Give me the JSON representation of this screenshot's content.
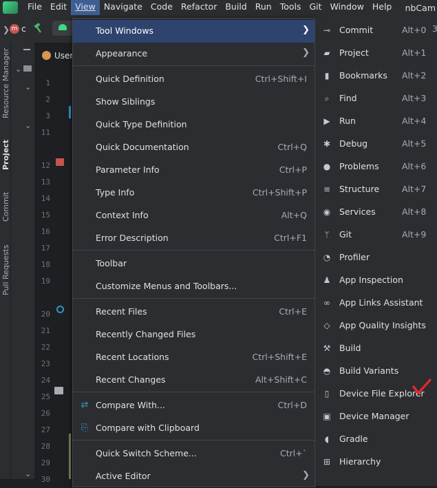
{
  "menubar": {
    "items": [
      "File",
      "Edit",
      "View",
      "Navigate",
      "Code",
      "Refactor",
      "Build",
      "Run",
      "Tools",
      "Git",
      "Window",
      "Help"
    ],
    "active": "View",
    "project_name": "nbCam"
  },
  "toolbar": {
    "project_badge": "m",
    "project_letter": "c"
  },
  "left_stripe": {
    "tabs": [
      "Resource Manager",
      "Project",
      "Commit",
      "Pull Requests"
    ]
  },
  "editor": {
    "tab_label": "User",
    "line_numbers": [
      "1",
      "2",
      "3",
      "11",
      "12",
      "13",
      "14",
      "15",
      "16",
      "17",
      "18",
      "19",
      "20",
      "21",
      "22",
      "23",
      "24",
      "25",
      "26",
      "27",
      "28",
      "29",
      "30"
    ]
  },
  "view_menu": {
    "tool_windows": "Tool Windows",
    "appearance": "Appearance",
    "quick_definition": "Quick Definition",
    "quick_definition_sc": "Ctrl+Shift+I",
    "show_siblings": "Show Siblings",
    "quick_type_definition": "Quick Type Definition",
    "quick_documentation": "Quick Documentation",
    "quick_documentation_sc": "Ctrl+Q",
    "parameter_info": "Parameter Info",
    "parameter_info_sc": "Ctrl+P",
    "type_info": "Type Info",
    "type_info_sc": "Ctrl+Shift+P",
    "context_info": "Context Info",
    "context_info_sc": "Alt+Q",
    "error_description": "Error Description",
    "error_description_sc": "Ctrl+F1",
    "toolbar": "Toolbar",
    "customize_menus": "Customize Menus and Toolbars...",
    "recent_files": "Recent Files",
    "recent_files_sc": "Ctrl+E",
    "recently_changed_files": "Recently Changed Files",
    "recent_locations": "Recent Locations",
    "recent_locations_sc": "Ctrl+Shift+E",
    "recent_changes": "Recent Changes",
    "recent_changes_sc": "Alt+Shift+C",
    "compare_with": "Compare With...",
    "compare_with_sc": "Ctrl+D",
    "compare_with_clipboard": "Compare with Clipboard",
    "quick_switch_scheme": "Quick Switch Scheme...",
    "quick_switch_scheme_sc": "Ctrl+`",
    "active_editor": "Active Editor"
  },
  "tool_windows_menu": {
    "items": [
      {
        "label": "Commit",
        "shortcut": "Alt+0",
        "icon": "commit-icon"
      },
      {
        "label": "Project",
        "shortcut": "Alt+1",
        "icon": "folder-icon"
      },
      {
        "label": "Bookmarks",
        "shortcut": "Alt+2",
        "icon": "bookmark-icon"
      },
      {
        "label": "Find",
        "shortcut": "Alt+3",
        "icon": "search-icon"
      },
      {
        "label": "Run",
        "shortcut": "Alt+4",
        "icon": "run-icon"
      },
      {
        "label": "Debug",
        "shortcut": "Alt+5",
        "icon": "bug-icon"
      },
      {
        "label": "Problems",
        "shortcut": "Alt+6",
        "icon": "problems-icon"
      },
      {
        "label": "Structure",
        "shortcut": "Alt+7",
        "icon": "structure-icon"
      },
      {
        "label": "Services",
        "shortcut": "Alt+8",
        "icon": "services-icon"
      },
      {
        "label": "Git",
        "shortcut": "Alt+9",
        "icon": "git-branch-icon"
      },
      {
        "label": "Profiler",
        "shortcut": "",
        "icon": "gauge-icon"
      },
      {
        "label": "App Inspection",
        "shortcut": "",
        "icon": "inspection-icon"
      },
      {
        "label": "App Links Assistant",
        "shortcut": "",
        "icon": "link-icon"
      },
      {
        "label": "App Quality Insights",
        "shortcut": "",
        "icon": "diamond-icon"
      },
      {
        "label": "Build",
        "shortcut": "",
        "icon": "hammer-icon"
      },
      {
        "label": "Build Variants",
        "shortcut": "",
        "icon": "android-icon"
      },
      {
        "label": "Device File Explorer",
        "shortcut": "",
        "icon": "device-icon"
      },
      {
        "label": "Device Manager",
        "shortcut": "",
        "icon": "device-manager-icon"
      },
      {
        "label": "Gradle",
        "shortcut": "",
        "icon": "gradle-icon"
      },
      {
        "label": "Hierarchy",
        "shortcut": "",
        "icon": "hierarchy-icon"
      }
    ],
    "cut_off_shortcut": "3"
  },
  "colors": {
    "menu_bg": "#2b2d30",
    "highlight": "#2e436e",
    "checkmark": "#e5252a",
    "accent_blue": "#3592c4"
  }
}
